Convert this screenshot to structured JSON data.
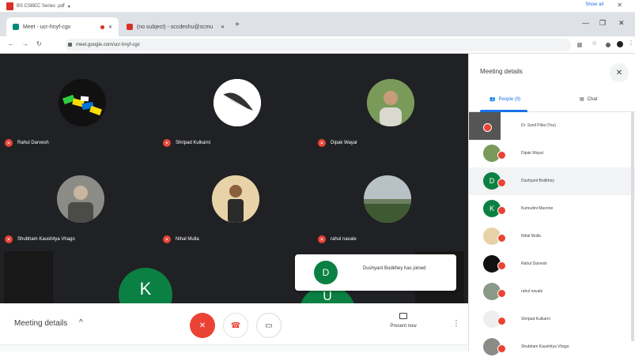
{
  "download_bar": {
    "file": "BS CSBEC Series .pdf",
    "show_all": "Show all"
  },
  "tabs": [
    {
      "label": "Meet - ucr-hnyf-cgv",
      "favicon_color": "#00897b",
      "active": true
    },
    {
      "label": "(no subject) - sccdeshu@scmu",
      "favicon_color": "#d93025",
      "active": false
    }
  ],
  "url": "meet.google.com/ucr-hnyf-cgv",
  "stage": {
    "tiles": [
      {
        "name": "Rahul Darvesh",
        "avatar_color": "#111111"
      },
      {
        "name": "Shripad Kulkarni",
        "avatar_color": "#ffffff"
      },
      {
        "name": "Dipak Wayal",
        "avatar_color": "#5f8a4a"
      },
      {
        "name": "Shubham Kaushitya Vhago",
        "avatar_color": "#6b7a7e"
      },
      {
        "name": "Nihal Mulla",
        "avatar_color": "#c2a36b"
      },
      {
        "name": "rahul navale",
        "avatar_color": "#5e6f57"
      }
    ],
    "big_initial_1": "K",
    "big_initial_2": "U"
  },
  "toast": {
    "initial": "D",
    "message": "Dushyant Bodkhey has joined"
  },
  "controls": {
    "details_label": "Meeting details",
    "present_label": "Present now"
  },
  "panel": {
    "title": "Meeting details",
    "people_tab": "People (9)",
    "chat_tab": "Chat",
    "people": [
      {
        "name": "Dr. Sunil Pillai (You)",
        "avatar_color": "#555555",
        "initial": ""
      },
      {
        "name": "Dipak Wayal",
        "avatar_color": "#7a9a5a",
        "initial": ""
      },
      {
        "name": "Dushyant Bodkhey",
        "avatar_color": "#0b8043",
        "initial": "D"
      },
      {
        "name": "Kumudini Mavrote",
        "avatar_color": "#0b8043",
        "initial": "K"
      },
      {
        "name": "Nihal Mulla",
        "avatar_color": "#c2a36b",
        "initial": ""
      },
      {
        "name": "Rahul Darvesh",
        "avatar_color": "#111111",
        "initial": ""
      },
      {
        "name": "rahul navale",
        "avatar_color": "#5e6f57",
        "initial": ""
      },
      {
        "name": "Shripad Kulkarni",
        "avatar_color": "#eeeeee",
        "initial": ""
      },
      {
        "name": "Shubham Kaushitya Vhago",
        "avatar_color": "#6b7a7e",
        "initial": ""
      }
    ]
  }
}
